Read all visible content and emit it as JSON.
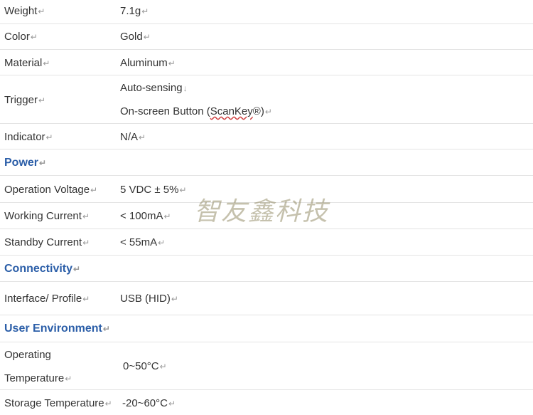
{
  "rows": {
    "weight": {
      "label": "Weight",
      "value": "7.1g"
    },
    "color": {
      "label": "Color",
      "value": "Gold"
    },
    "material": {
      "label": "Material",
      "value": "Aluminum"
    },
    "trigger": {
      "label": "Trigger",
      "value_line1": "Auto-sensing",
      "value_line2_pre": "On-screen Button (",
      "value_line2_mark": "ScanKey",
      "value_line2_post": "®)"
    },
    "indicator": {
      "label": "Indicator",
      "value": "N/A"
    },
    "op_voltage": {
      "label": "Operation Voltage",
      "value": "5 VDC ± 5%"
    },
    "work_curr": {
      "label": "Working Current",
      "value": "< 100mA"
    },
    "stby_curr": {
      "label": "Standby Current",
      "value": "< 55mA"
    },
    "interface": {
      "label": "Interface/ Profile",
      "value": "USB (HID)"
    },
    "op_temp": {
      "label_line1": "Operating",
      "label_line2": "Temperature",
      "value": "0~50°C"
    },
    "st_temp": {
      "label": "Storage Temperature",
      "value": "-20~60°C"
    }
  },
  "sections": {
    "power": "Power",
    "connectivity": "Connectivity",
    "user_env": "User Environment"
  },
  "marks": {
    "paragraph": "↵",
    "linebreak": "↓"
  },
  "watermark": "智友鑫科技",
  "colors": {
    "section": "#2b5ea8",
    "text": "#333333",
    "divider": "#e4e4e4"
  }
}
